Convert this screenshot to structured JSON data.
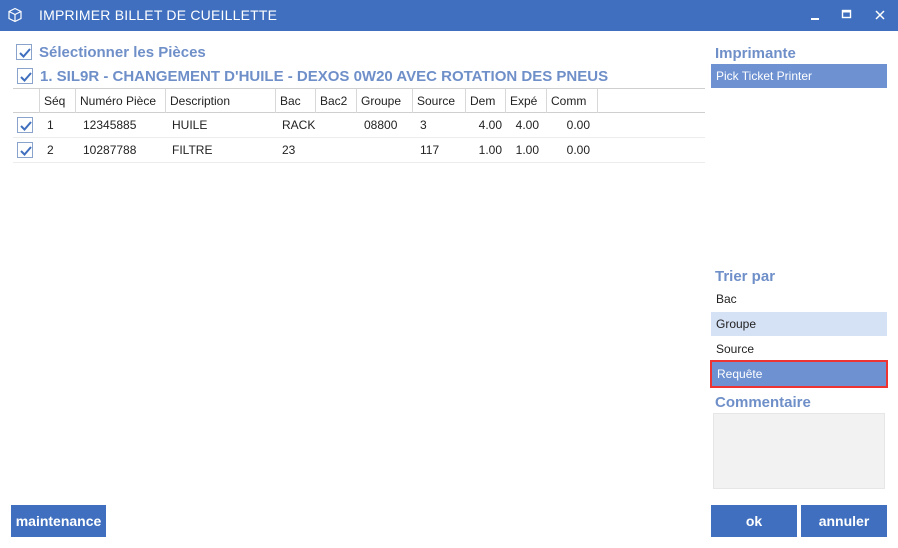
{
  "window": {
    "title": "IMPRIMER BILLET DE CUEILLETTE",
    "icon": "cube-icon",
    "controls": [
      "minimize-icon",
      "maximize-icon",
      "close-icon"
    ]
  },
  "select_parts": {
    "label": "Sélectionner les Pièces",
    "checked": true
  },
  "job": {
    "label": "1. SIL9R - CHANGEMENT D'HUILE - DEXOS 0W20 AVEC ROTATION DES PNEUS",
    "checked": true
  },
  "table": {
    "columns": [
      "Séq",
      "Numéro Pièce",
      "Description",
      "Bac",
      "Bac2",
      "Groupe",
      "Source",
      "Dem",
      "Expé",
      "Comm"
    ],
    "rows": [
      {
        "checked": true,
        "seq": "1",
        "part": "12345885",
        "desc": "HUILE",
        "bac": "RACK",
        "bac2": "",
        "groupe": "08800",
        "source": "3",
        "dem": "4.00",
        "expe": "4.00",
        "comm": "0.00"
      },
      {
        "checked": true,
        "seq": "2",
        "part": "10287788",
        "desc": "FILTRE",
        "bac": "23",
        "bac2": "",
        "groupe": "",
        "source": "117",
        "dem": "1.00",
        "expe": "1.00",
        "comm": "0.00"
      }
    ]
  },
  "printer": {
    "title": "Imprimante",
    "selected": "Pick Ticket Printer"
  },
  "sort": {
    "title": "Trier par",
    "options": [
      "Bac",
      "Groupe",
      "Source",
      "Requête"
    ]
  },
  "comment": {
    "title": "Commentaire",
    "value": ""
  },
  "buttons": {
    "maintenance": "maintenance",
    "ok": "ok",
    "cancel": "annuler"
  },
  "colors": {
    "accent": "#3f6fbe",
    "heading": "#6f8fc9",
    "selection": "#6d91d1",
    "selection_light": "#d5e1f5",
    "focus_outline": "#e33333"
  }
}
